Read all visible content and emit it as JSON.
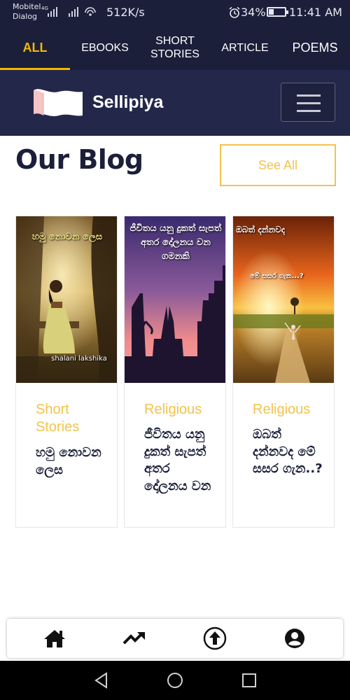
{
  "status_bar": {
    "carrier_line1": "Mobitel",
    "carrier_line2": "Dialog",
    "network_tag": "4G",
    "speed": "512K/s",
    "battery_level": 0.34,
    "battery": "34%",
    "time": "11:41 AM"
  },
  "tabs": [
    {
      "label": "ALL",
      "active": true
    },
    {
      "label": "EBOOKS",
      "active": false
    },
    {
      "label": "SHORT STORIES",
      "active": false
    },
    {
      "label": "ARTICLE",
      "active": false
    },
    {
      "label": "POEMS",
      "active": false
    }
  ],
  "header": {
    "logo_text": "Sellipiya",
    "menu_icon": "hamburger-menu-icon"
  },
  "blog": {
    "title": "Our Blog",
    "see_all": "See All"
  },
  "cards": [
    {
      "category": "Short Stories",
      "title": "හමු නොවන ලෙස",
      "image_caption": "හමු නොවන ලෙස",
      "image_author": "shalani lakshika"
    },
    {
      "category": "Religious",
      "title": "ජීවිතය යනු දුකත් සැපත් අතර දෝලනය වන",
      "image_caption": "ජීවිතය යනු දුකත් සැපත් අතර දෝලනය වන ගමනකි"
    },
    {
      "category": "Religious",
      "title": "ඔබත් දන්නවද මේ සසර ගැන..?",
      "image_caption": "ඔබත් දන්නවද",
      "image_subcaption": "මේ සසර ගැන...?"
    }
  ],
  "bottom_nav": [
    {
      "icon": "home-icon"
    },
    {
      "icon": "trending-icon"
    },
    {
      "icon": "upload-icon"
    },
    {
      "icon": "account-icon"
    }
  ],
  "system_nav": [
    "back-icon",
    "home-circle-icon",
    "recents-icon"
  ],
  "colors": {
    "navy": "#1b1f3a",
    "header_navy": "#23274a",
    "accent_yellow": "#f2b705",
    "category_yellow": "#f2c34b"
  }
}
